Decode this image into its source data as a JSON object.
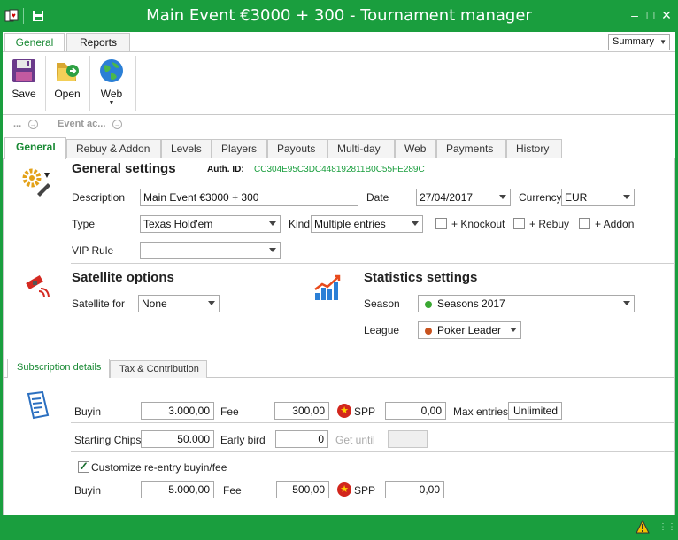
{
  "window": {
    "title": "Main Event €3000 + 300 - Tournament manager"
  },
  "ribbon": {
    "tabs": [
      "General",
      "Reports"
    ],
    "view_select": "Summary",
    "buttons": {
      "save": "Save",
      "open": "Open",
      "web": "Web"
    }
  },
  "nav": {
    "back": "...",
    "event": "Event ac..."
  },
  "tabs": [
    "General",
    "Rebuy & Addon",
    "Levels",
    "Players",
    "Payouts",
    "Multi-day",
    "Web",
    "Payments",
    "History"
  ],
  "general": {
    "title": "General settings",
    "auth_label": "Auth. ID:",
    "auth_value": "CC304E95C3DC448192811B0C55FE289C",
    "description_label": "Description",
    "description_value": "Main Event €3000 + 300",
    "date_label": "Date",
    "date_value": "27/04/2017",
    "currency_label": "Currency",
    "currency_value": "EUR",
    "type_label": "Type",
    "type_value": "Texas Hold'em",
    "kind_label": "Kind",
    "kind_value": "Multiple entries",
    "knockout_label": "+ Knockout",
    "rebuy_label": "+ Rebuy",
    "addon_label": "+ Addon",
    "vip_label": "VIP Rule",
    "vip_value": ""
  },
  "satellite": {
    "title": "Satellite options",
    "for_label": "Satellite for",
    "for_value": "None"
  },
  "statistics": {
    "title": "Statistics settings",
    "season_label": "Season",
    "season_value": "Seasons 2017",
    "season_color": "#3aa832",
    "league_label": "League",
    "league_value": "Poker Leader",
    "league_color": "#c8521e"
  },
  "subtabs": [
    "Subscription details",
    "Tax & Contribution"
  ],
  "subscription": {
    "buyin_label": "Buyin",
    "buyin_value": "3.000,00",
    "fee_label": "Fee",
    "fee_value": "300,00",
    "spp_label": "SPP",
    "spp_value": "0,00",
    "maxentries_label": "Max entries",
    "maxentries_value": "Unlimited",
    "chips_label": "Starting Chips",
    "chips_value": "50.000",
    "earlybird_label": "Early bird",
    "earlybird_value": "0",
    "getuntil_label": "Get until",
    "getuntil_value": "",
    "customize_label": "Customize re-entry buyin/fee",
    "re_buyin_label": "Buyin",
    "re_buyin_value": "5.000,00",
    "re_fee_label": "Fee",
    "re_fee_value": "500,00",
    "re_spp_label": "SPP",
    "re_spp_value": "0,00"
  }
}
